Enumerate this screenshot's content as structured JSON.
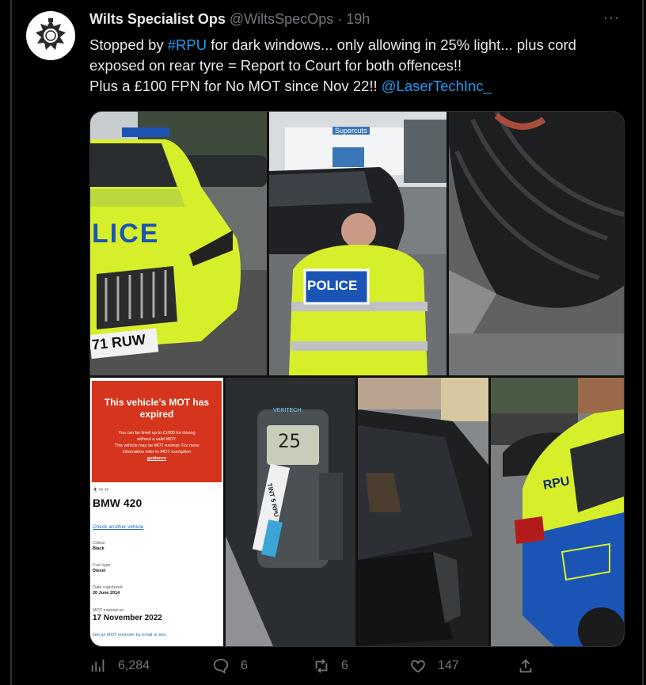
{
  "tweet": {
    "display_name": "Wilts Specialist Ops",
    "handle": "@WiltsSpecOps",
    "separator": "·",
    "time": "19h",
    "more": "···",
    "text": {
      "l1_a": "Stopped by ",
      "l1_tag": "#RPU",
      "l1_b": " for dark windows... only allowing in 25% light... plus cord",
      "l2": "exposed on rear tyre = Report to Court for both offences!!",
      "l3_a": "Plus a £100 FPN for No MOT since Nov 22!! ",
      "l3_mention": "@LaserTechInc_"
    }
  },
  "media": {
    "photo1": {
      "police_text": "LICE",
      "plate": "71 RUW"
    },
    "photo2": {
      "shop_sign": "Supercuts",
      "vest_text": "POLICE"
    },
    "mot": {
      "heading_l1": "This vehicle's MOT has",
      "heading_l2": "expired",
      "body_l1": "You can be fined up to £1000 for driving",
      "body_l2": "without a valid MOT.",
      "body_l3": "This vehicle may be MOT exempt. For more",
      "body_l4": "information refer to MOT exemption",
      "body_l5": "guidance",
      "reg_blurred": "₹ ⁴⁶ ᵛ⁶",
      "model": "BMW 420",
      "check_link": "Check another vehicle",
      "colour_label": "Colour",
      "colour_value": "Black",
      "fuel_label": "Fuel type",
      "fuel_value": "Diesel",
      "date_label": "Date registered",
      "date_value": "20 June 2014",
      "expired_label": "MOT expired on",
      "expired_value": "17 November 2022",
      "reminder": "Get an MOT reminder by email or text."
    },
    "meter": {
      "reading": "25",
      "label": "TINT 5 RPU",
      "brand": "VERITECH"
    },
    "car_rpu": {
      "text": "RPU"
    }
  },
  "actions": {
    "views": "6,284",
    "replies": "6",
    "retweets": "6",
    "likes": "147"
  },
  "colors": {
    "accent": "#1d9bf0",
    "muted": "#71767b",
    "mot_red": "#d4351c",
    "hiviz": "#d7ef2a",
    "police_blue": "#1a55b5"
  }
}
